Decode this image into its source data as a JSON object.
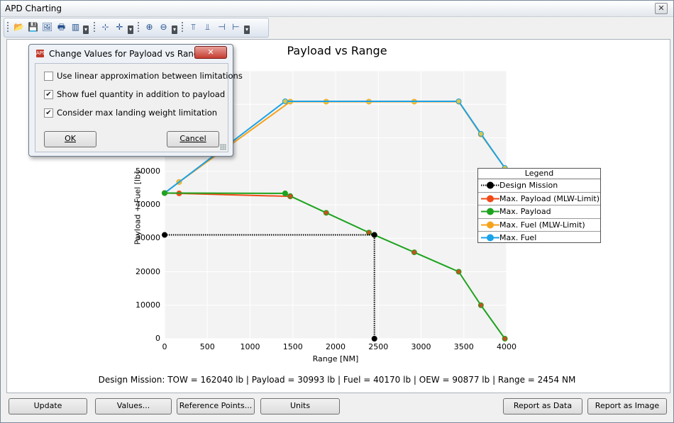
{
  "window": {
    "title": "APD Charting",
    "close_glyph": "✕"
  },
  "toolbar": {
    "groups": [
      [
        "open-icon",
        "save-icon",
        "export-image-icon",
        "print-icon",
        "chart-type-icon"
      ],
      [
        "zoom-x-icon",
        "zoom-xy-icon"
      ],
      [
        "zoom-in-icon",
        "zoom-out-icon"
      ],
      [
        "align-top-icon",
        "align-bottom-icon",
        "align-left-icon",
        "align-right-icon"
      ]
    ]
  },
  "chart_data": {
    "type": "line",
    "title": "Payload vs Range",
    "xlabel": "Range [NM]",
    "ylabel": "Payload + Fuel [lb]",
    "xlim": [
      0,
      4000
    ],
    "ylim": [
      0,
      80000
    ],
    "xticks": [
      0,
      500,
      1000,
      1500,
      2000,
      2500,
      3000,
      3500,
      4000
    ],
    "yticks": [
      0,
      10000,
      20000,
      30000,
      40000,
      50000
    ],
    "grid": true,
    "legend": {
      "title": "Legend",
      "placement": "right",
      "entries": [
        "Design Mission",
        "Max. Payload (MLW-Limit)",
        "Max. Payload",
        "Max. Fuel (MLW-Limit)",
        "Max. Fuel"
      ]
    },
    "series": [
      {
        "name": "Max. Fuel (MLW-Limit)",
        "color": "#f7a21b",
        "style": "solid",
        "points": [
          [
            0,
            43500
          ],
          [
            170,
            46800
          ],
          [
            1470,
            70800
          ],
          [
            1890,
            70800
          ],
          [
            2390,
            70800
          ],
          [
            2920,
            70800
          ],
          [
            3440,
            70800
          ],
          [
            3700,
            61000
          ],
          [
            3980,
            51000
          ]
        ]
      },
      {
        "name": "Max. Fuel",
        "color": "#1aa3e8",
        "style": "solid",
        "points": [
          [
            0,
            43500
          ],
          [
            1410,
            70900
          ],
          [
            3440,
            70900
          ],
          [
            3700,
            61200
          ],
          [
            3980,
            51000
          ]
        ]
      },
      {
        "name": "Max. Payload (MLW-Limit)",
        "color": "#f04a18",
        "style": "solid",
        "points": [
          [
            0,
            43500
          ],
          [
            170,
            43400
          ],
          [
            1470,
            42500
          ]
        ]
      },
      {
        "name": "Max. Payload",
        "color": "#1ea31e",
        "style": "solid",
        "points": [
          [
            0,
            43500
          ],
          [
            1410,
            43400
          ],
          [
            1470,
            42600
          ],
          [
            1890,
            37600
          ],
          [
            2390,
            31700
          ],
          [
            2454,
            30993
          ],
          [
            2920,
            25800
          ],
          [
            3440,
            20000
          ],
          [
            3700,
            10000
          ],
          [
            3980,
            0
          ]
        ]
      },
      {
        "name": "Design Mission",
        "color": "#000000",
        "style": "dotted",
        "points": [
          [
            0,
            30993
          ],
          [
            2454,
            30993
          ],
          [
            2454,
            0
          ]
        ]
      }
    ]
  },
  "status_text": "Design Mission: TOW = 162040 lb | Payload = 30993 lb | Fuel = 40170 lb | OEW = 90877 lb | Range = 2454 NM",
  "buttons": {
    "update": "Update",
    "values": "Values...",
    "reference_points": "Reference Points...",
    "units": "Units",
    "report_data": "Report as Data",
    "report_image": "Report as Image"
  },
  "dialog": {
    "title": "Change Values for Payload vs Range",
    "options": [
      {
        "label": "Use linear approximation between limitations",
        "checked": false
      },
      {
        "label": "Show fuel quantity in addition to payload",
        "checked": true
      },
      {
        "label": "Consider max landing weight limitation",
        "checked": true
      }
    ],
    "ok": "OK",
    "cancel": "Cancel",
    "close_glyph": "✕"
  }
}
